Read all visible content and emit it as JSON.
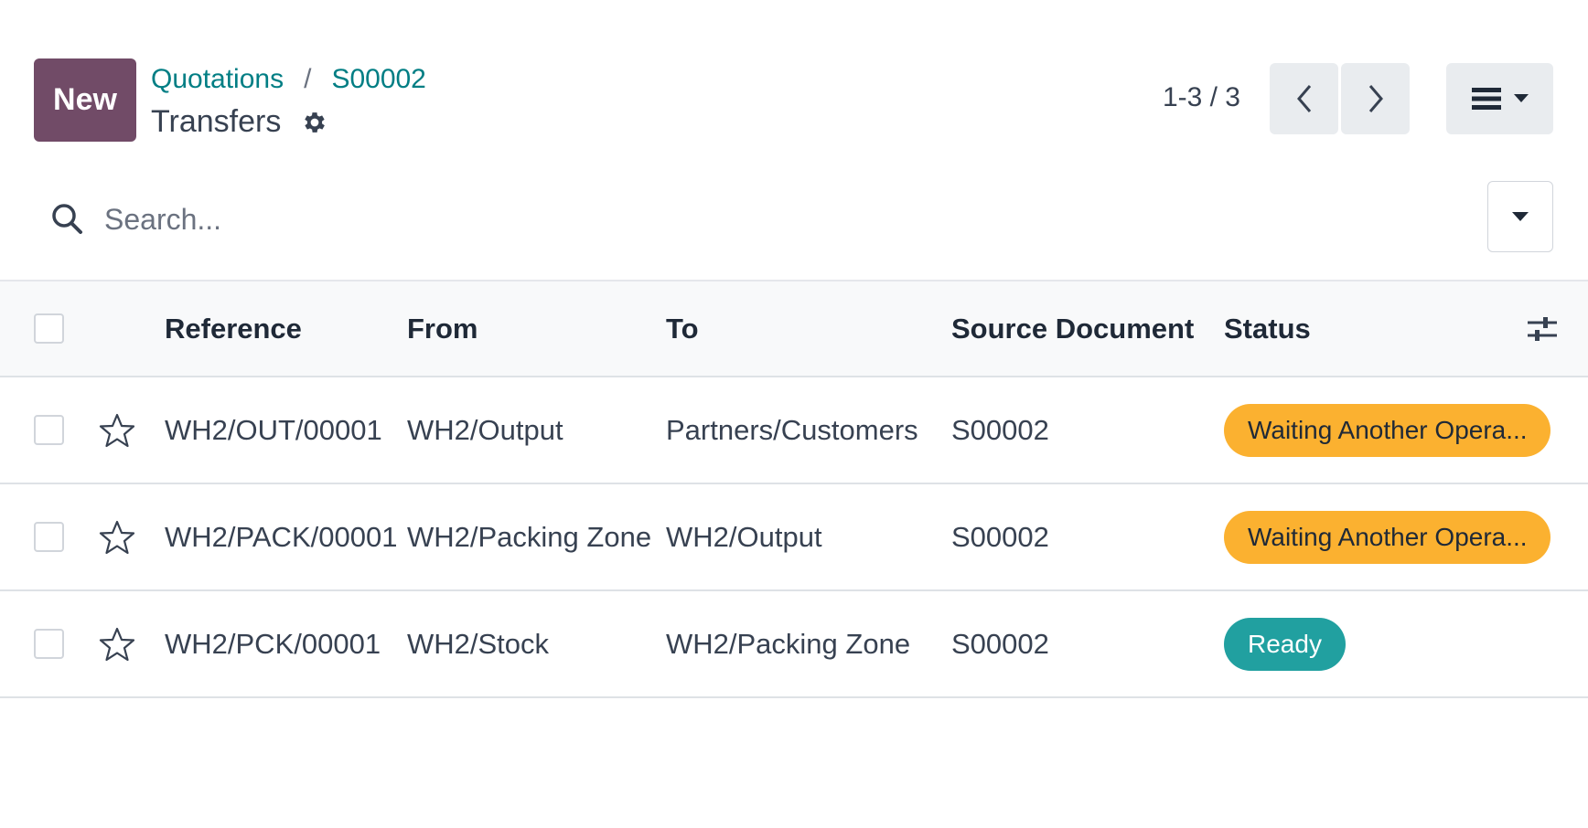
{
  "control_panel": {
    "new_label": "New",
    "breadcrumb": [
      {
        "label": "Quotations"
      },
      {
        "label": "S00002"
      }
    ],
    "breadcrumb_separator": "/",
    "page_title": "Transfers",
    "pager_value": "1-3 / 3"
  },
  "search": {
    "placeholder": "Search..."
  },
  "table": {
    "columns": {
      "reference": "Reference",
      "from": "From",
      "to": "To",
      "source_document": "Source Document",
      "status": "Status"
    },
    "rows": [
      {
        "reference": "WH2/OUT/00001",
        "from": "WH2/Output",
        "to": "Partners/Customers",
        "source_document": "S00002",
        "status": "Waiting Another Opera..."
      },
      {
        "reference": "WH2/PACK/00001",
        "from": "WH2/Packing Zone",
        "to": "WH2/Output",
        "source_document": "S00002",
        "status": "Waiting Another Opera..."
      },
      {
        "reference": "WH2/PCK/00001",
        "from": "WH2/Stock",
        "to": "WH2/Packing Zone",
        "source_document": "S00002",
        "status": "Ready"
      }
    ]
  },
  "colors": {
    "brand": "#714b67",
    "link": "#017e84",
    "waiting": "#fbb130",
    "ready": "#21a0a0"
  },
  "icons": {
    "gear": "gear-icon",
    "prev": "chevron-left-icon",
    "next": "chevron-right-icon",
    "view": "list-view-icon",
    "search": "search-icon",
    "toggle": "caret-down-icon",
    "star": "star-icon",
    "optional_columns": "sliders-icon"
  }
}
